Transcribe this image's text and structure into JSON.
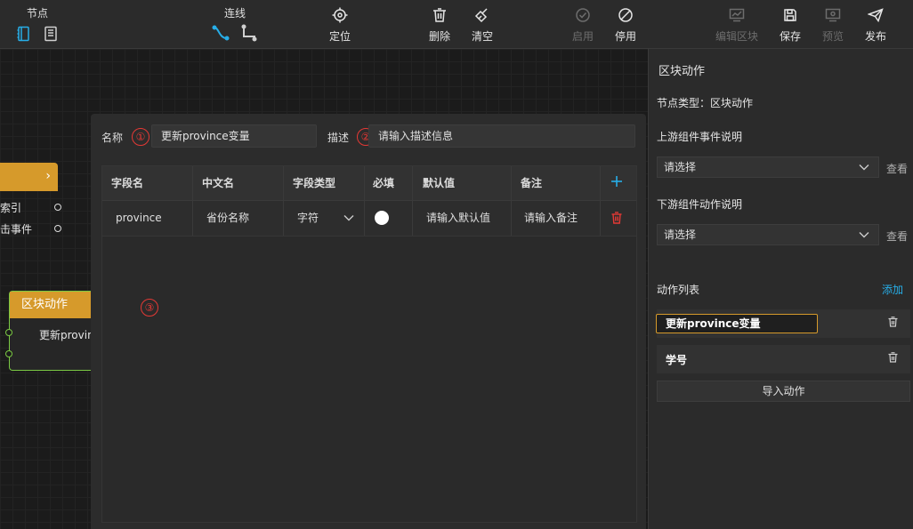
{
  "toolbar": {
    "node_group": {
      "caption": "节点"
    },
    "line_group": {
      "caption": "连线"
    },
    "buttons": {
      "locate": "定位",
      "delete": "删除",
      "clear": "清空",
      "enable": "启用",
      "disable": "停用",
      "edit_block": "编辑区块",
      "save": "保存",
      "preview": "预览",
      "publish": "发布"
    }
  },
  "canvas": {
    "node1": {
      "row1": "索引",
      "row2": "击事件"
    },
    "node2": {
      "title": "区块动作",
      "row1": "更新provin"
    }
  },
  "dialog": {
    "name_label": "名称",
    "name_value": "更新province变量",
    "desc_label": "描述",
    "desc_placeholder": "请输入描述信息",
    "marker1": "①",
    "marker2": "②",
    "marker3": "③",
    "columns": [
      "字段名",
      "中文名",
      "字段类型",
      "必填",
      "默认值",
      "备注"
    ],
    "rows": [
      {
        "field": "province",
        "cn_name": "省份名称",
        "type": "字符",
        "default_placeholder": "请输入默认值",
        "remark_placeholder": "请输入备注"
      }
    ]
  },
  "right_panel": {
    "title": "区块动作",
    "node_type": "节点类型：区块动作",
    "upstream_label": "上游组件事件说明",
    "upstream_select": "请选择",
    "upstream_view": "查看",
    "downstream_label": "下游组件动作说明",
    "downstream_select": "请选择",
    "downstream_view": "查看",
    "action_list_label": "动作列表",
    "add_link": "添加",
    "actions": [
      {
        "name": "更新province变量"
      },
      {
        "name": "学号"
      }
    ],
    "import_button": "导入动作"
  },
  "colors": {
    "accent": "#27aee8",
    "node_header": "#d69a2b",
    "node_border": "#7ac943",
    "danger": "#e53935",
    "highlight_border": "#d69a2b"
  }
}
